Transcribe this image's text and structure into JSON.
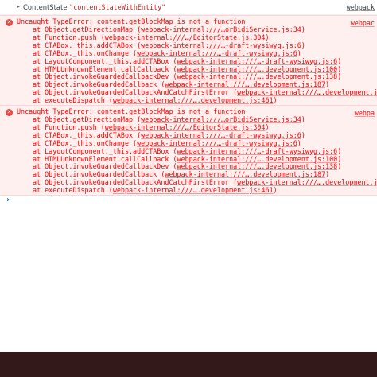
{
  "log_entry": {
    "toggle": "▶",
    "label": "ContentState",
    "value": "\"contentStateWithEntity\"",
    "source": "webpack"
  },
  "errors": [
    {
      "message": "Uncaught TypeError: content.getBlockMap is not a function",
      "source": "webpac",
      "frames": [
        {
          "fn": "at Object.getDirectionMap (",
          "link": "webpack-internal:///…orBidiService.js:34",
          "end": ")"
        },
        {
          "fn": "at Function.push (",
          "link": "webpack-internal:///…/EditorState.js:304",
          "end": ")"
        },
        {
          "fn": "at CTABox._this.addCTABox (",
          "link": "webpack-internal:///…-draft-wysiwyg.js:6",
          "end": ")"
        },
        {
          "fn": "at CTABox._this.onChange (",
          "link": "webpack-internal:///…-draft-wysiwyg.js:6",
          "end": ")"
        },
        {
          "fn": "at LayoutComponent._this.addCTABox (",
          "link": "webpack-internal:///…-draft-wysiwyg.js:6",
          "end": ")"
        },
        {
          "fn": "at HTMLUnknownElement.callCallback (",
          "link": "webpack-internal:///….development.js:100",
          "end": ")"
        },
        {
          "fn": "at Object.invokeGuardedCallbackDev (",
          "link": "webpack-internal:///….development.js:138",
          "end": ")"
        },
        {
          "fn": "at Object.invokeGuardedCallback (",
          "link": "webpack-internal:///….development.js:187",
          "end": ")"
        },
        {
          "fn": "at Object.invokeGuardedCallbackAndCatchFirstError (",
          "link": "webpack-internal:///….development.j",
          "end": ""
        },
        {
          "fn": "at executeDispatch (",
          "link": "webpack-internal:///….development.js:461",
          "end": ")"
        }
      ]
    },
    {
      "message": "Uncaught TypeError: content.getBlockMap is not a function",
      "source": "webpa",
      "frames": [
        {
          "fn": "at Object.getDirectionMap (",
          "link": "webpack-internal:///…orBidiService.js:34",
          "end": ")"
        },
        {
          "fn": "at Function.push (",
          "link": "webpack-internal:///…/EditorState.js:304",
          "end": ")"
        },
        {
          "fn": "at CTABox._this.addCTABox (",
          "link": "webpack-internal:///…-draft-wysiwyg.js:6",
          "end": ")"
        },
        {
          "fn": "at CTABox._this.onChange (",
          "link": "webpack-internal:///…-draft-wysiwyg.js:6",
          "end": ")"
        },
        {
          "fn": "at LayoutComponent._this.addCTABox (",
          "link": "webpack-internal:///…-draft-wysiwyg.js:6",
          "end": ")"
        },
        {
          "fn": "at HTMLUnknownElement.callCallback (",
          "link": "webpack-internal:///….development.js:100",
          "end": ")"
        },
        {
          "fn": "at Object.invokeGuardedCallbackDev (",
          "link": "webpack-internal:///….development.js:138",
          "end": ")"
        },
        {
          "fn": "at Object.invokeGuardedCallback (",
          "link": "webpack-internal:///….development.js:187",
          "end": ")"
        },
        {
          "fn": "at Object.invokeGuardedCallbackAndCatchFirstError (",
          "link": "webpack-internal:///….development.j",
          "end": ""
        },
        {
          "fn": "at executeDispatch (",
          "link": "webpack-internal:///….development.js:461",
          "end": ")"
        }
      ]
    }
  ],
  "prompt": "›",
  "colors": {
    "error_text": "#fe0000",
    "error_bg": "#fff0f0",
    "prompt": "#1a73e8",
    "bottom_bar": "#33191a"
  }
}
